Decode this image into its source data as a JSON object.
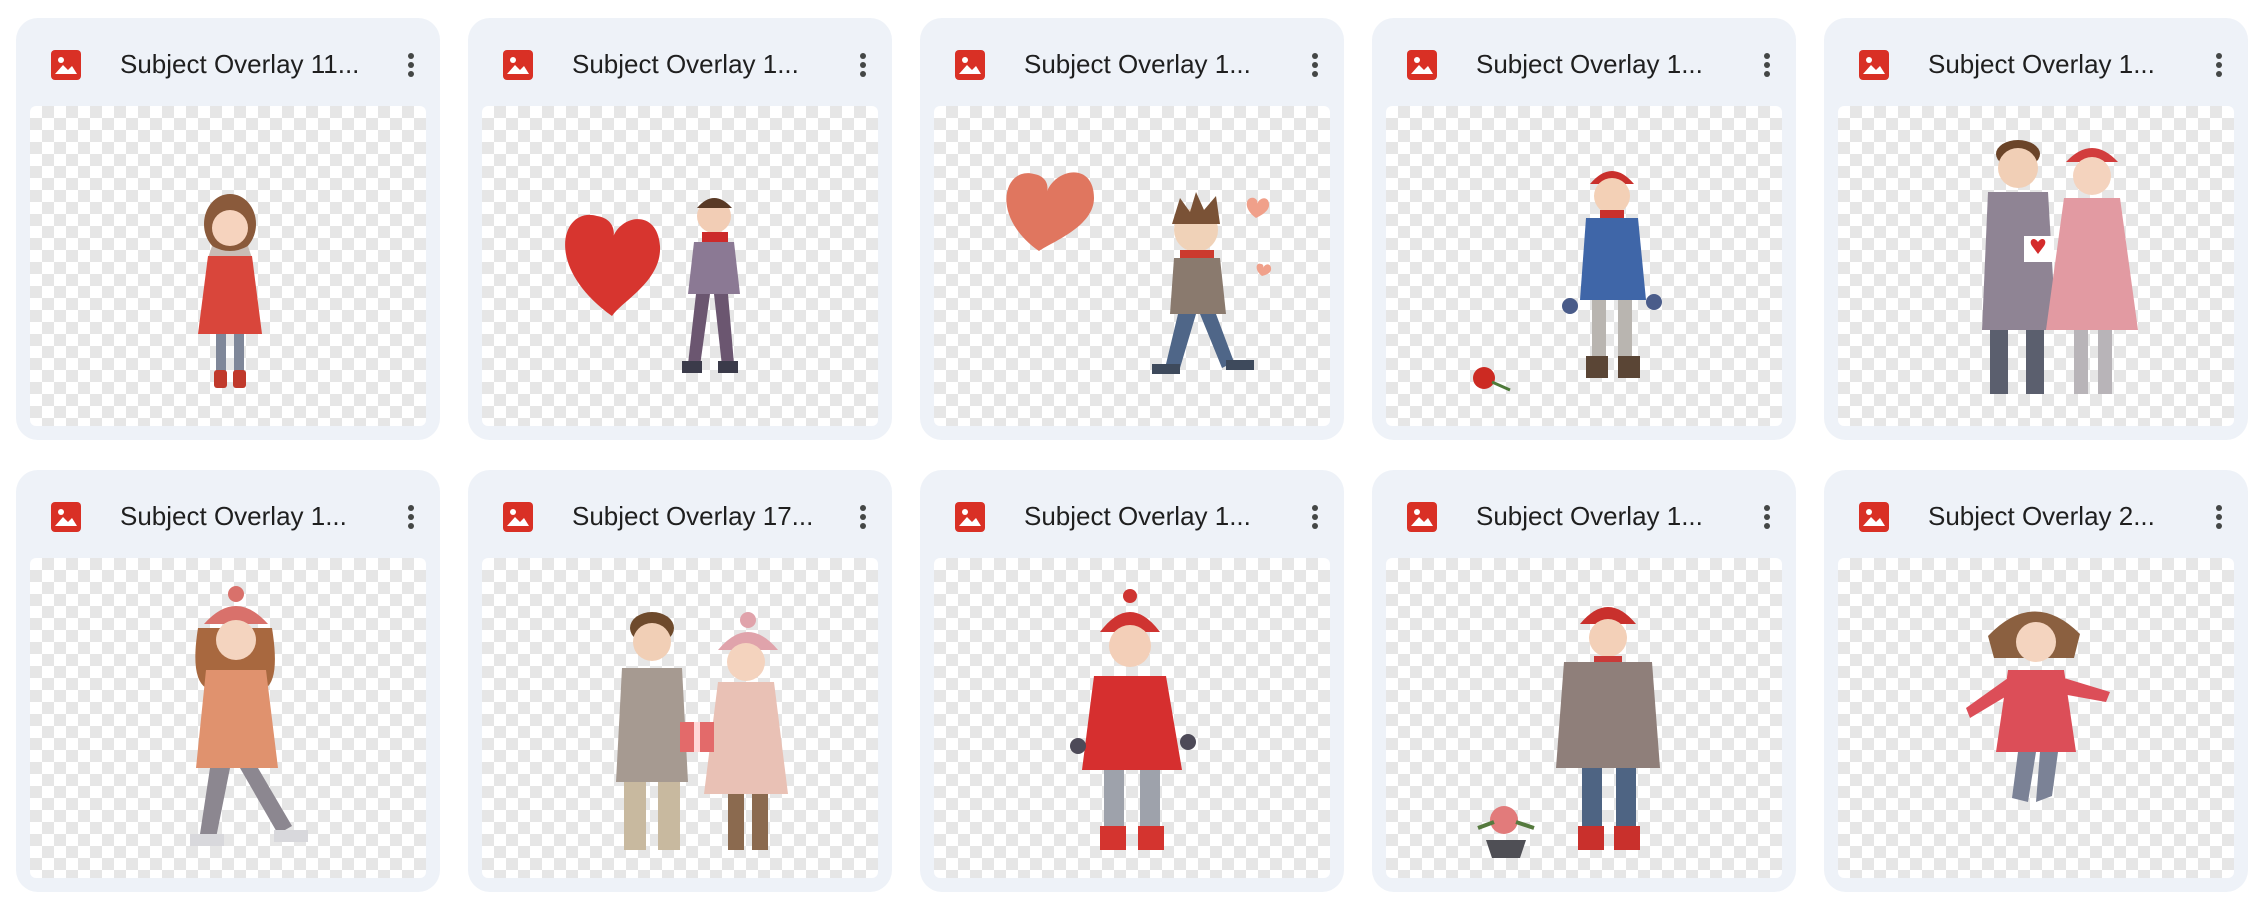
{
  "files": [
    {
      "title": "Subject Overlay 11...",
      "icon": "image-file-icon",
      "menu_icon": "more-vert-icon",
      "thumbnail": "girl-red-coat"
    },
    {
      "title": "Subject Overlay 1...",
      "icon": "image-file-icon",
      "menu_icon": "more-vert-icon",
      "thumbnail": "boy-skating-heart"
    },
    {
      "title": "Subject Overlay 1...",
      "icon": "image-file-icon",
      "menu_icon": "more-vert-icon",
      "thumbnail": "boy-skating-hearts"
    },
    {
      "title": "Subject Overlay 1...",
      "icon": "image-file-icon",
      "menu_icon": "more-vert-icon",
      "thumbnail": "boy-blue-jacket-rose"
    },
    {
      "title": "Subject Overlay 1...",
      "icon": "image-file-icon",
      "menu_icon": "more-vert-icon",
      "thumbnail": "couple-gift"
    },
    {
      "title": "Subject Overlay 1...",
      "icon": "image-file-icon",
      "menu_icon": "more-vert-icon",
      "thumbnail": "girl-skating-hat"
    },
    {
      "title": "Subject Overlay 17...",
      "icon": "image-file-icon",
      "menu_icon": "more-vert-icon",
      "thumbnail": "couple-exchange-gift"
    },
    {
      "title": "Subject Overlay 1...",
      "icon": "image-file-icon",
      "menu_icon": "more-vert-icon",
      "thumbnail": "kid-red-jacket"
    },
    {
      "title": "Subject Overlay 1...",
      "icon": "image-file-icon",
      "menu_icon": "more-vert-icon",
      "thumbnail": "boy-scarf-roses"
    },
    {
      "title": "Subject Overlay 2...",
      "icon": "image-file-icon",
      "menu_icon": "more-vert-icon",
      "thumbnail": "girl-jumping"
    }
  ],
  "colors": {
    "card_bg": "#eef2f8",
    "icon_red": "#d93025",
    "title_text": "#1f1f1f",
    "menu_dots": "#444746"
  }
}
